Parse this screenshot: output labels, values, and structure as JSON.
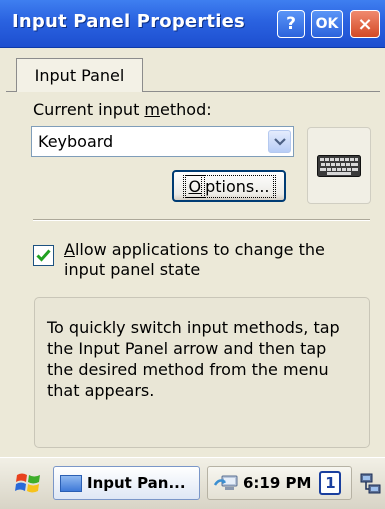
{
  "window": {
    "title": "Input Panel Properties",
    "help_label": "?",
    "ok_label": "OK",
    "close_label": "×"
  },
  "tabs": [
    {
      "label": "Input Panel",
      "selected": true
    }
  ],
  "input_method": {
    "label_prefix": "Current input ",
    "label_accel": "m",
    "label_suffix": "ethod:",
    "selected": "Keyboard",
    "icon": "keyboard-icon"
  },
  "options_button": {
    "label_accel": "O",
    "label_rest": "ptions..."
  },
  "allow_change": {
    "checked": true,
    "label_accel": "A",
    "label_rest": "llow applications to change the input panel state"
  },
  "info_text": "To quickly switch input methods, tap the Input Panel arrow and then tap the desired method from the menu that appears.",
  "taskbar": {
    "start_icon": "windows-flag-icon",
    "task_label": "Input Pan...",
    "clock": "6:19 PM",
    "input_badge": "1",
    "tray_icon": "network-icon"
  },
  "colors": {
    "titlebar": "#2a62e0",
    "close_button": "#d44a26",
    "window_bg": "#ece9d8",
    "checkmark": "#21a121"
  }
}
